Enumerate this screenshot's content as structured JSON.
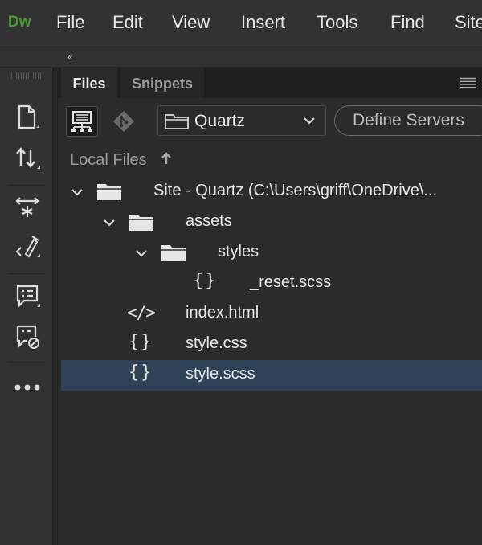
{
  "app": {
    "logo": "Dw",
    "menu": [
      "File",
      "Edit",
      "View",
      "Insert",
      "Tools",
      "Find",
      "Site"
    ]
  },
  "collapse": {
    "label": "‹‹"
  },
  "toolbar": {
    "icons": [
      "new-document-icon",
      "get-put-icon",
      "expand-collapse-icon",
      "code-formatting-icon",
      "comment-icon",
      "remove-comment-icon",
      "more-icon"
    ]
  },
  "panel": {
    "tabs": {
      "files": "Files",
      "snippets": "Snippets"
    },
    "site_select": {
      "value": "Quartz"
    },
    "define_servers": "Define Servers",
    "local_files": "Local Files",
    "tree": {
      "site_root": "Site - Quartz (C:\\Users\\griff\\OneDrive\\...",
      "assets": "assets",
      "styles": "styles",
      "reset_scss": "_reset.scss",
      "index_html": "index.html",
      "style_css": "style.css",
      "style_scss": "style.scss"
    },
    "code_glyph": "</>",
    "brace_glyph": "{}"
  },
  "colors": {
    "logo": "#4a9c35",
    "selected_row": "#304257",
    "background": "#2b2b2b"
  }
}
